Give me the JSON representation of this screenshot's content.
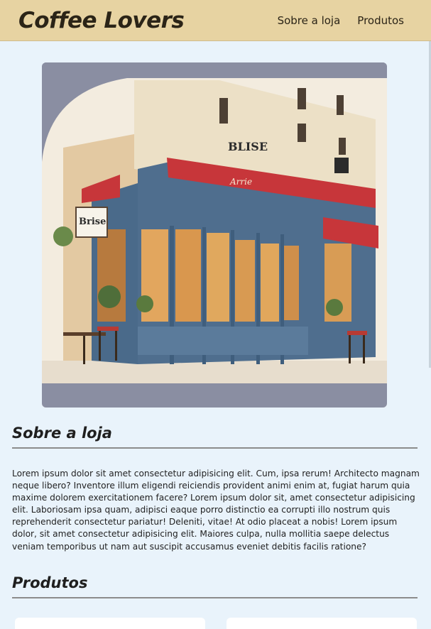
{
  "header": {
    "brand": "Coffee Lovers",
    "nav": [
      {
        "label": "Sobre a loja"
      },
      {
        "label": "Produtos"
      }
    ]
  },
  "hero": {
    "shop_sign": "BLISE",
    "awning_text": "Arrie",
    "board_text": "Brise"
  },
  "about": {
    "title": "Sobre a loja",
    "text": "Lorem ipsum dolor sit amet consectetur adipisicing elit. Cum, ipsa rerum! Architecto magnam neque libero? Inventore illum eligendi reiciendis provident animi enim at, fugiat harum quia maxime dolorem exercitationem facere? Lorem ipsum dolor sit, amet consectetur adipisicing elit. Laboriosam ipsa quam, adipisci eaque porro distinctio ea corrupti illo nostrum quis reprehenderit consectetur pariatur! Deleniti, vitae! At odio placeat a nobis! Lorem ipsum dolor, sit amet consectetur adipisicing elit. Maiores culpa, nulla mollitia saepe delectus veniam temporibus ut nam aut suscipit accusamus eveniet debitis facilis ratione?"
  },
  "products": {
    "title": "Produtos"
  }
}
